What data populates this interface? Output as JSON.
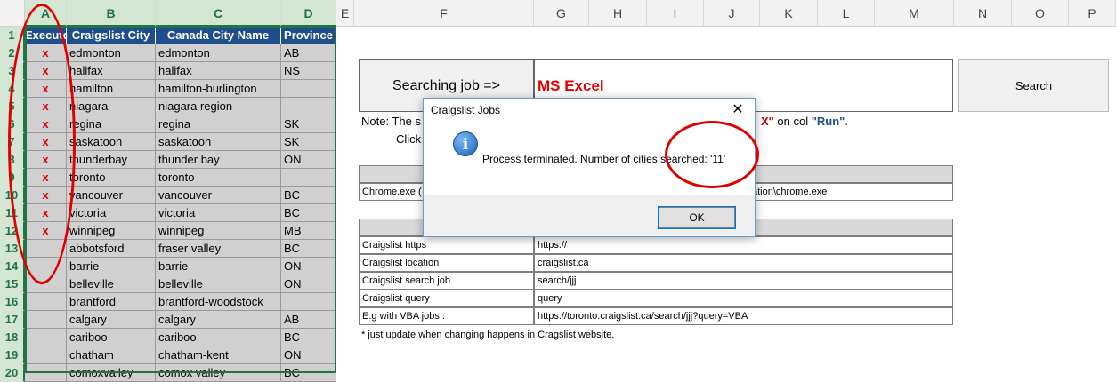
{
  "columns": [
    "A",
    "B",
    "C",
    "D",
    "E",
    "F",
    "G",
    "H",
    "I",
    "J",
    "K",
    "L",
    "M",
    "N",
    "O",
    "P"
  ],
  "rows": [
    "1",
    "2",
    "3",
    "4",
    "5",
    "6",
    "7",
    "8",
    "9",
    "10",
    "11",
    "12",
    "13",
    "14",
    "15",
    "16",
    "17",
    "18",
    "19",
    "20"
  ],
  "table": {
    "headers": [
      "Execute",
      "Craigslist City",
      "Canada City Name",
      "Province"
    ],
    "data": [
      [
        "x",
        "edmonton",
        "edmonton",
        "AB"
      ],
      [
        "x",
        "halifax",
        "halifax",
        "NS"
      ],
      [
        "x",
        "hamilton",
        "hamilton-burlington",
        ""
      ],
      [
        "x",
        "niagara",
        "niagara region",
        ""
      ],
      [
        "x",
        "regina",
        "regina",
        "SK"
      ],
      [
        "x",
        "saskatoon",
        "saskatoon",
        "SK"
      ],
      [
        "x",
        "thunderbay",
        "thunder bay",
        "ON"
      ],
      [
        "x",
        "toronto",
        "toronto",
        ""
      ],
      [
        "x",
        "vancouver",
        "vancouver",
        "BC"
      ],
      [
        "x",
        "victoria",
        "victoria",
        "BC"
      ],
      [
        "x",
        "winnipeg",
        "winnipeg",
        "MB"
      ],
      [
        "",
        "abbotsford",
        "fraser valley",
        "BC"
      ],
      [
        "",
        "barrie",
        "barrie",
        "ON"
      ],
      [
        "",
        "belleville",
        "belleville",
        "ON"
      ],
      [
        "",
        "brantford",
        "brantford-woodstock",
        ""
      ],
      [
        "",
        "calgary",
        "calgary",
        "AB"
      ],
      [
        "",
        "cariboo",
        "cariboo",
        "BC"
      ],
      [
        "",
        "chatham",
        "chatham-kent",
        "ON"
      ],
      [
        "",
        "comoxvalley",
        "comox valley",
        "BC"
      ]
    ]
  },
  "search": {
    "label": "Searching job =>",
    "term": "MS Excel",
    "button": "Search"
  },
  "note": {
    "line1_start": "Note: The s",
    "line1_mark": "X\"",
    "line1_mid": " on col ",
    "line1_run": "\"Run\"",
    "line1_end": ".",
    "line2": "Click"
  },
  "chrome_row": {
    "label": "Chrome.exe (",
    "value": "ation\\chrome.exe"
  },
  "config": [
    {
      "label": "Craigslist https",
      "value": "https://"
    },
    {
      "label": "Craigslist location",
      "value": "craigslist.ca"
    },
    {
      "label": "Craigslist search job",
      "value": "search/jjj"
    },
    {
      "label": "Craigslist query",
      "value": "query"
    },
    {
      "label": "E.g with VBA jobs :",
      "value": "https://toronto.craigslist.ca/search/jjj?query=VBA"
    }
  ],
  "footnote": "* just update when changing happens in Cragslist website.",
  "dialog": {
    "title": "Craigslist Jobs",
    "close": "✕",
    "icon": "i",
    "message": "Process terminated. Number of cities searched: '11'",
    "ok": "OK"
  },
  "colors": {
    "header_bg": "#1f4e8c",
    "mark": "#e00000",
    "selection": "#217346"
  }
}
